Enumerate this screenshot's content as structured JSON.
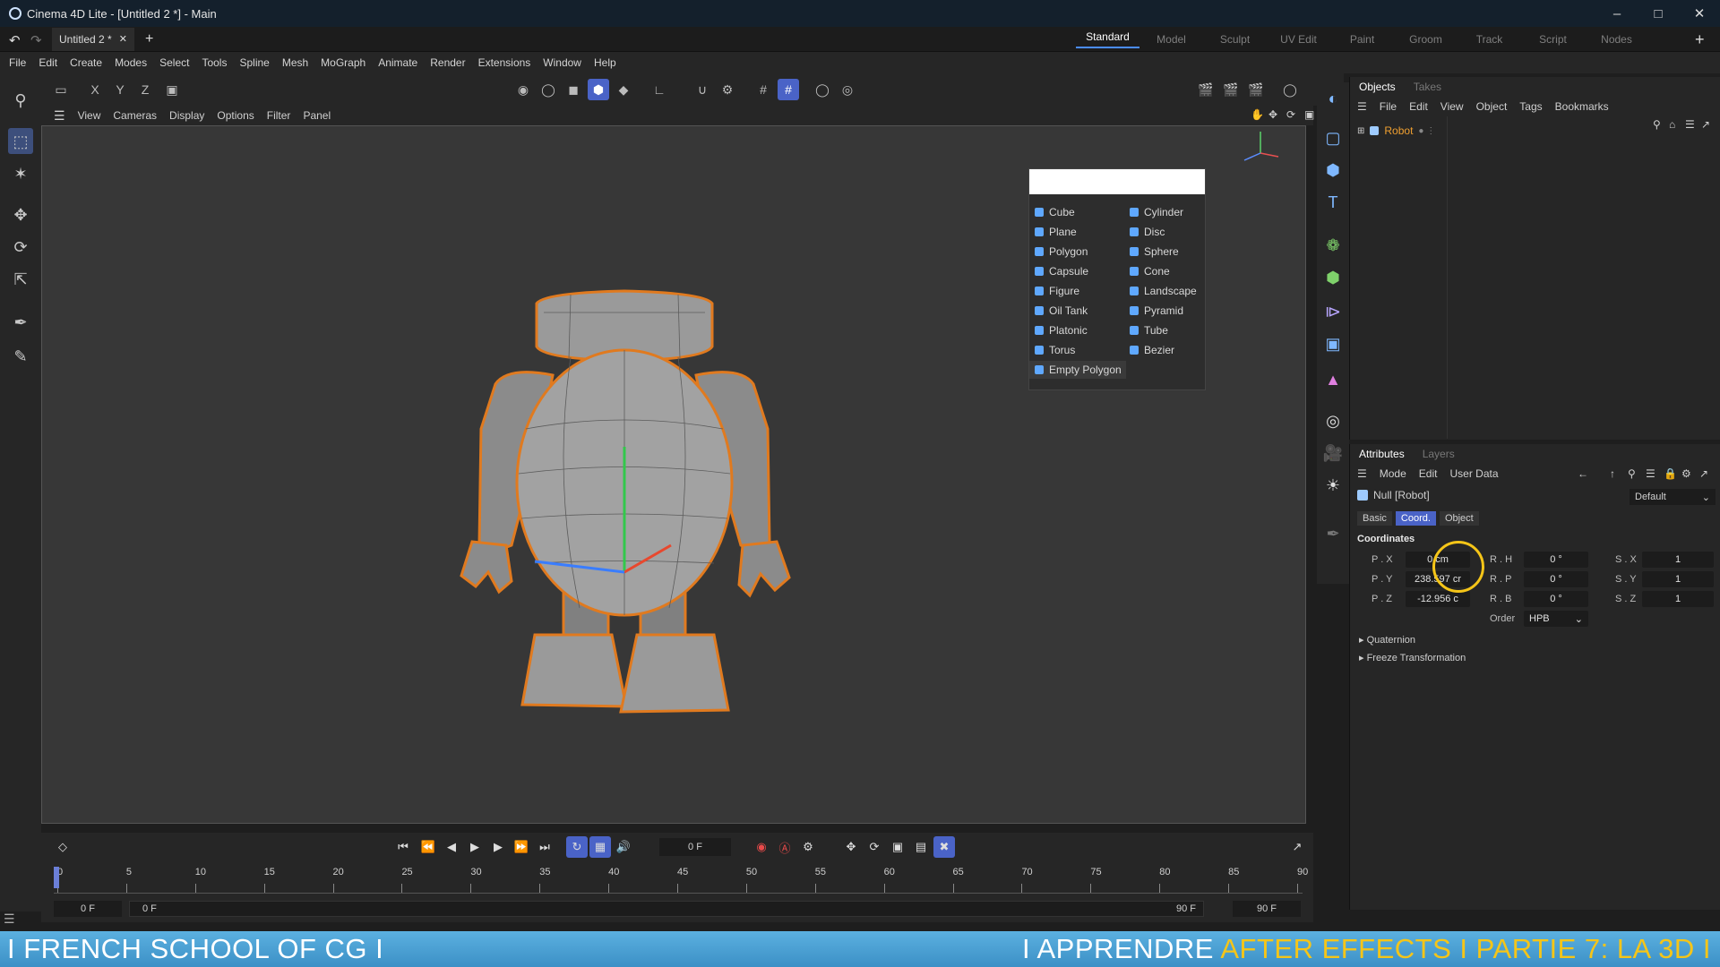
{
  "window": {
    "title": "Cinema 4D Lite - [Untitled 2 *] - Main"
  },
  "doc_tab": {
    "label": "Untitled 2 *"
  },
  "layouts": [
    "Standard",
    "Model",
    "Sculpt",
    "UV Edit",
    "Paint",
    "Groom",
    "Track",
    "Script",
    "Nodes"
  ],
  "menu": [
    "File",
    "Edit",
    "Create",
    "Modes",
    "Select",
    "Tools",
    "Spline",
    "Mesh",
    "MoGraph",
    "Animate",
    "Render",
    "Extensions",
    "Window",
    "Help"
  ],
  "axis_buttons": [
    "X",
    "Y",
    "Z"
  ],
  "viewport_menu": [
    "View",
    "Cameras",
    "Display",
    "Options",
    "Filter",
    "Panel"
  ],
  "popup": {
    "left": [
      "Cube",
      "Plane",
      "Polygon",
      "Capsule",
      "Figure",
      "Oil Tank",
      "Platonic",
      "Torus",
      "Empty Polygon"
    ],
    "right": [
      "Cylinder",
      "Disc",
      "Sphere",
      "Cone",
      "Landscape",
      "Pyramid",
      "Tube",
      "Bezier"
    ]
  },
  "objects_panel": {
    "tabs": [
      "Objects",
      "Takes"
    ],
    "menu": [
      "File",
      "Edit",
      "View",
      "Object",
      "Tags",
      "Bookmarks"
    ],
    "tree": [
      {
        "name": "Robot"
      }
    ]
  },
  "attributes_panel": {
    "tabs": [
      "Attributes",
      "Layers"
    ],
    "menu": [
      "Mode",
      "Edit",
      "User Data"
    ],
    "object_name": "Null [Robot]",
    "preset": "Default",
    "subtabs": [
      "Basic",
      "Coord.",
      "Object"
    ],
    "section": "Coordinates",
    "rows": [
      {
        "p_label": "P . X",
        "p_value": "0 cm",
        "r_label": "R . H",
        "r_value": "0 °",
        "s_label": "S . X",
        "s_value": "1"
      },
      {
        "p_label": "P . Y",
        "p_value": "238.597 cr",
        "r_label": "R . P",
        "r_value": "0 °",
        "s_label": "S . Y",
        "s_value": "1"
      },
      {
        "p_label": "P . Z",
        "p_value": "-12.956 c",
        "r_label": "R . B",
        "r_value": "0 °",
        "s_label": "S . Z",
        "s_value": "1"
      }
    ],
    "order_label": "Order",
    "order_value": "HPB",
    "collapsibles": [
      "Quaternion",
      "Freeze Transformation"
    ]
  },
  "timeline": {
    "current_frame": "0 F",
    "ticks": [
      "0",
      "5",
      "10",
      "15",
      "20",
      "25",
      "30",
      "35",
      "40",
      "45",
      "50",
      "55",
      "60",
      "65",
      "70",
      "75",
      "80",
      "85",
      "90"
    ],
    "range_start": "0 F",
    "range_start2": "0 F",
    "range_end": "90 F",
    "range_end2": "90 F"
  },
  "banner": {
    "left": "I FRENCH SCHOOL OF CG I",
    "right_part1": "I APPRENDRE ",
    "right_part2": "AFTER EFFECTS",
    "right_part3": " I PARTIE 7: LA 3D I"
  },
  "colors": {
    "accent": "#4a63c7",
    "banner": "#4fa7db",
    "highlight": "#f5c518",
    "robot_outline": "#e07a1f"
  }
}
